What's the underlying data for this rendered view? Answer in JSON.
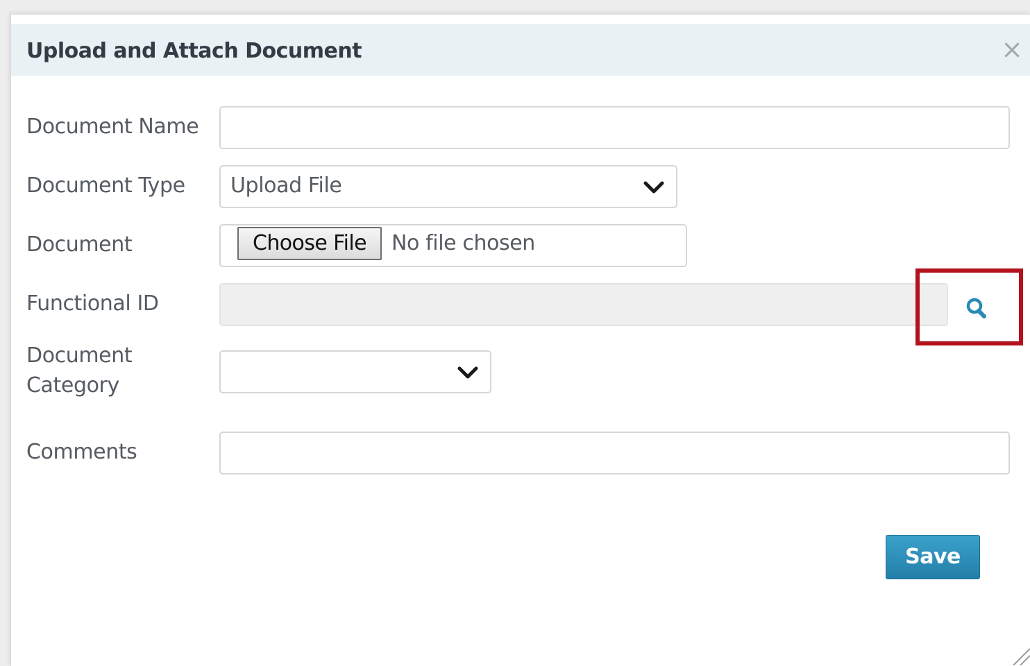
{
  "dialog": {
    "title": "Upload and Attach Document",
    "close_symbol": "×",
    "highlight_color": "#b3121c",
    "accent_color": "#2a8ab5"
  },
  "form": {
    "document_name": {
      "label": "Document Name",
      "value": ""
    },
    "document_type": {
      "label": "Document Type",
      "selected": "Upload File",
      "icon": "chevron-down-icon"
    },
    "document": {
      "label": "Document",
      "button_label": "Choose File",
      "status_text": "No file chosen"
    },
    "functional_id": {
      "label": "Functional ID",
      "value": "",
      "lookup_icon": "search-icon"
    },
    "document_category": {
      "label_line1": "Document",
      "label_line2": "Category",
      "selected": "",
      "icon": "chevron-down-icon"
    },
    "comments": {
      "label": "Comments",
      "value": ""
    }
  },
  "footer": {
    "save_label": "Save"
  }
}
